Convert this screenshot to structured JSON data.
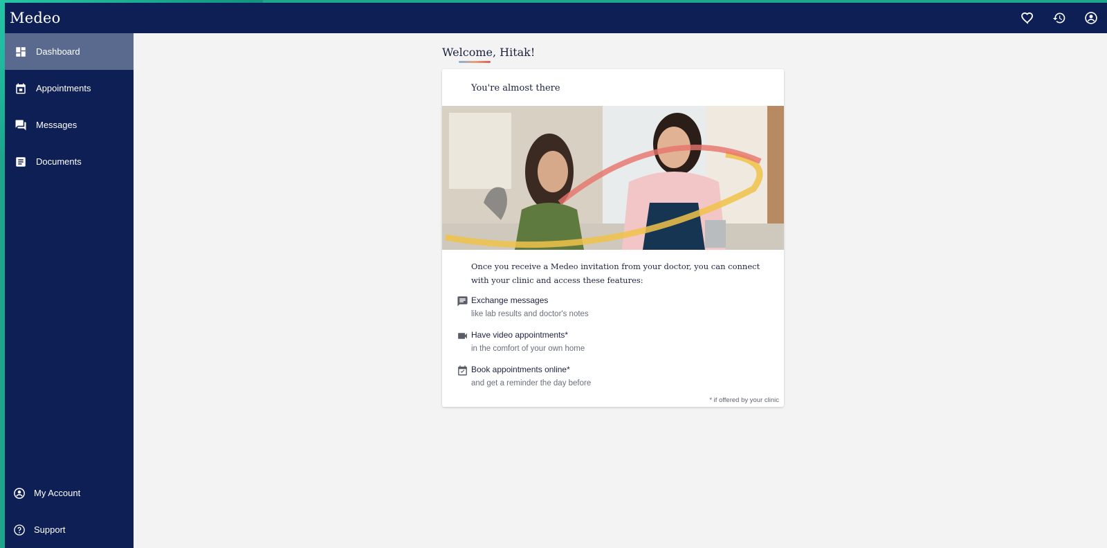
{
  "app": {
    "logo": "Medeo"
  },
  "topbar": {
    "icons": [
      "heart-icon",
      "history-icon",
      "account-circle-icon"
    ]
  },
  "sidebar": {
    "items": [
      {
        "label": "Dashboard",
        "icon": "dashboard-icon",
        "active": true
      },
      {
        "label": "Appointments",
        "icon": "calendar-icon",
        "active": false
      },
      {
        "label": "Messages",
        "icon": "chat-icon",
        "active": false
      },
      {
        "label": "Documents",
        "icon": "document-icon",
        "active": false
      }
    ],
    "bottom": [
      {
        "label": "My Account",
        "icon": "account-circle-icon"
      },
      {
        "label": "Support",
        "icon": "help-circle-icon"
      }
    ]
  },
  "main": {
    "welcome": "Welcome, Hitak!",
    "card": {
      "title": "You're almost there",
      "intro_line1": "Once you receive a Medeo invitation from your doctor, you can connect",
      "intro_line2": "with your clinic and access these features:",
      "features": [
        {
          "icon": "message-icon",
          "title": "Exchange messages",
          "subtitle": "like lab results and doctor's notes"
        },
        {
          "icon": "video-camera-icon",
          "title": "Have video appointments*",
          "subtitle": "in the comfort of your own home"
        },
        {
          "icon": "calendar-check-icon",
          "title": "Book appointments online*",
          "subtitle": "and get a reminder the day before"
        }
      ],
      "footnote": "* if offered by your clinic"
    }
  },
  "colors": {
    "navy": "#0e1f55",
    "active_item": "#5a6a8f",
    "background": "#f3f3f3",
    "accent_teal": "#1ea58a"
  }
}
